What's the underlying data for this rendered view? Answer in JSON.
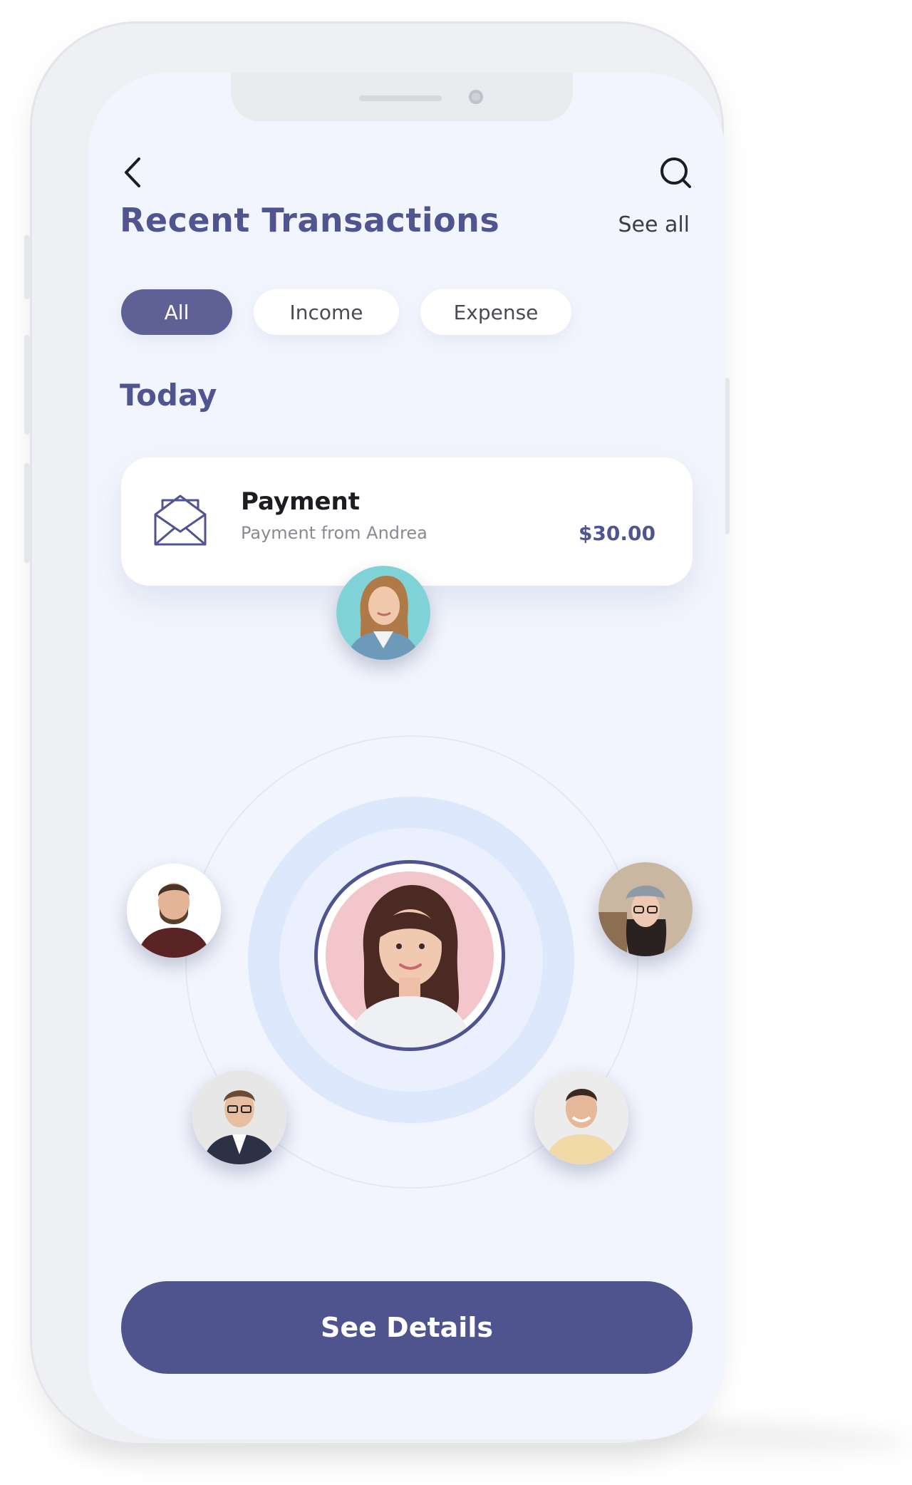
{
  "header": {
    "title": "Recent Transactions",
    "see_all": "See all",
    "back_icon": "chevron-left-icon",
    "search_icon": "search-icon"
  },
  "filters": [
    {
      "label": "All",
      "active": true
    },
    {
      "label": "Income",
      "active": false
    },
    {
      "label": "Expense",
      "active": false
    }
  ],
  "section": {
    "title": "Today"
  },
  "transaction": {
    "icon": "envelope-icon",
    "title": "Payment",
    "subtitle": "Payment from Andrea",
    "amount": "$30.00"
  },
  "contacts": {
    "center": {
      "icon": "avatar-woman-center"
    },
    "orbit": [
      {
        "icon": "avatar-woman-top"
      },
      {
        "icon": "avatar-man-left"
      },
      {
        "icon": "avatar-woman-right"
      },
      {
        "icon": "avatar-man-bottom-left"
      },
      {
        "icon": "avatar-man-bottom-right"
      }
    ]
  },
  "cta": {
    "label": "See Details"
  },
  "colors": {
    "primary": "#4f538e",
    "title": "#50548f",
    "screen_bg": "#f2f5fd",
    "ring": "#dde8fc"
  }
}
